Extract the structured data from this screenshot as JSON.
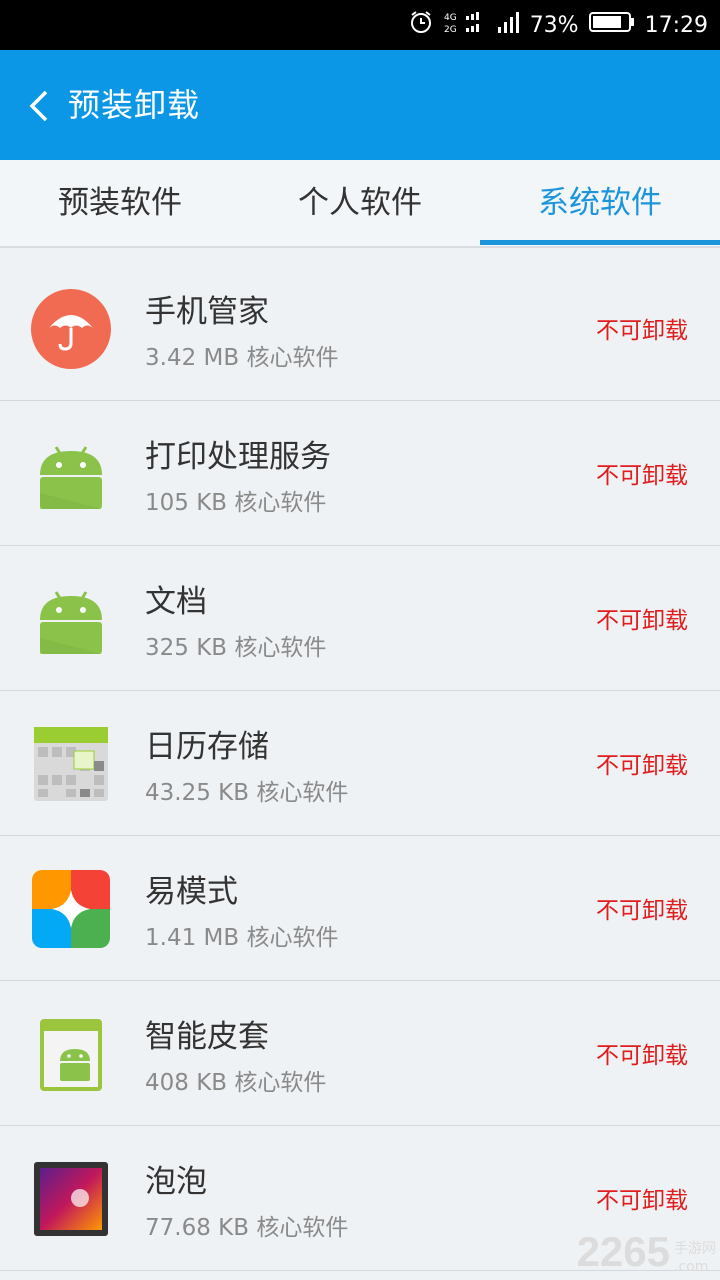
{
  "status_bar": {
    "battery": "73%",
    "time": "17:29",
    "network": "4G 2G"
  },
  "header": {
    "title": "预装卸载"
  },
  "tabs": [
    {
      "label": "预装软件"
    },
    {
      "label": "个人软件"
    },
    {
      "label": "系统软件"
    }
  ],
  "apps": [
    {
      "name": "手机管家",
      "size": "3.42 MB",
      "category": "核心软件",
      "action": "不可卸载",
      "icon": "umbrella-icon"
    },
    {
      "name": "打印处理服务",
      "size": "105 KB",
      "category": "核心软件",
      "action": "不可卸载",
      "icon": "android-icon"
    },
    {
      "name": "文档",
      "size": "325 KB",
      "category": "核心软件",
      "action": "不可卸载",
      "icon": "android-icon"
    },
    {
      "name": "日历存储",
      "size": "43.25 KB",
      "category": "核心软件",
      "action": "不可卸载",
      "icon": "calendar-grid-icon"
    },
    {
      "name": "易模式",
      "size": "1.41 MB",
      "category": "核心软件",
      "action": "不可卸载",
      "icon": "easy-mode-icon"
    },
    {
      "name": "智能皮套",
      "size": "408 KB",
      "category": "核心软件",
      "action": "不可卸载",
      "icon": "android-case-icon"
    },
    {
      "name": "泡泡",
      "size": "77.68 KB",
      "category": "核心软件",
      "action": "不可卸载",
      "icon": "bubble-photo-icon"
    }
  ],
  "watermark": {
    "brand": "2265",
    "suffix": ".com",
    "label": "手游网"
  },
  "colors": {
    "header": "#0b97e6",
    "accent": "#1c95dd",
    "action": "#e11c1c"
  }
}
